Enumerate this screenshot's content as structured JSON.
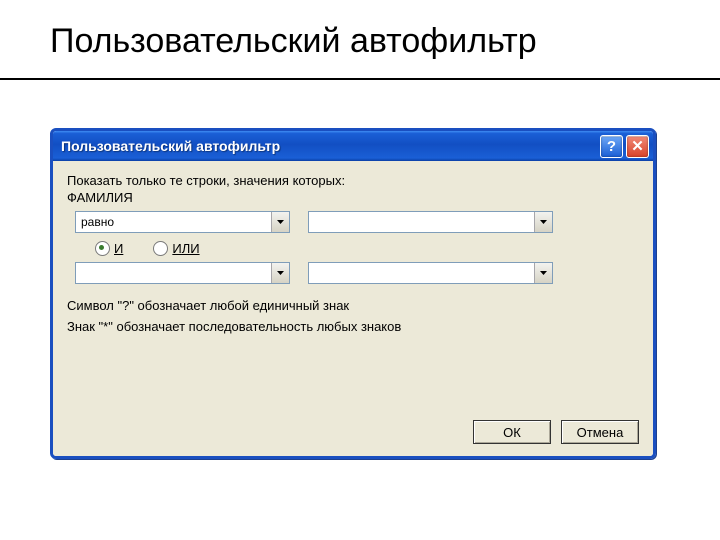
{
  "slide": {
    "title": "Пользовательский автофильтр"
  },
  "window": {
    "title": "Пользовательский автофильтр",
    "help_btn": "?",
    "close_btn": "✕",
    "prompt": "Показать только те строки, значения которых:",
    "field": "ФАМИЛИЯ",
    "row1": {
      "condition": "равно",
      "value": ""
    },
    "logic": {
      "and": "И",
      "or": "ИЛИ",
      "selected": "and"
    },
    "row2": {
      "condition": "",
      "value": ""
    },
    "hint1": "Символ \"?\" обозначает любой единичный знак",
    "hint2": "Знак \"*\" обозначает последовательность любых знаков",
    "ok": "ОК",
    "cancel": "Отмена"
  }
}
